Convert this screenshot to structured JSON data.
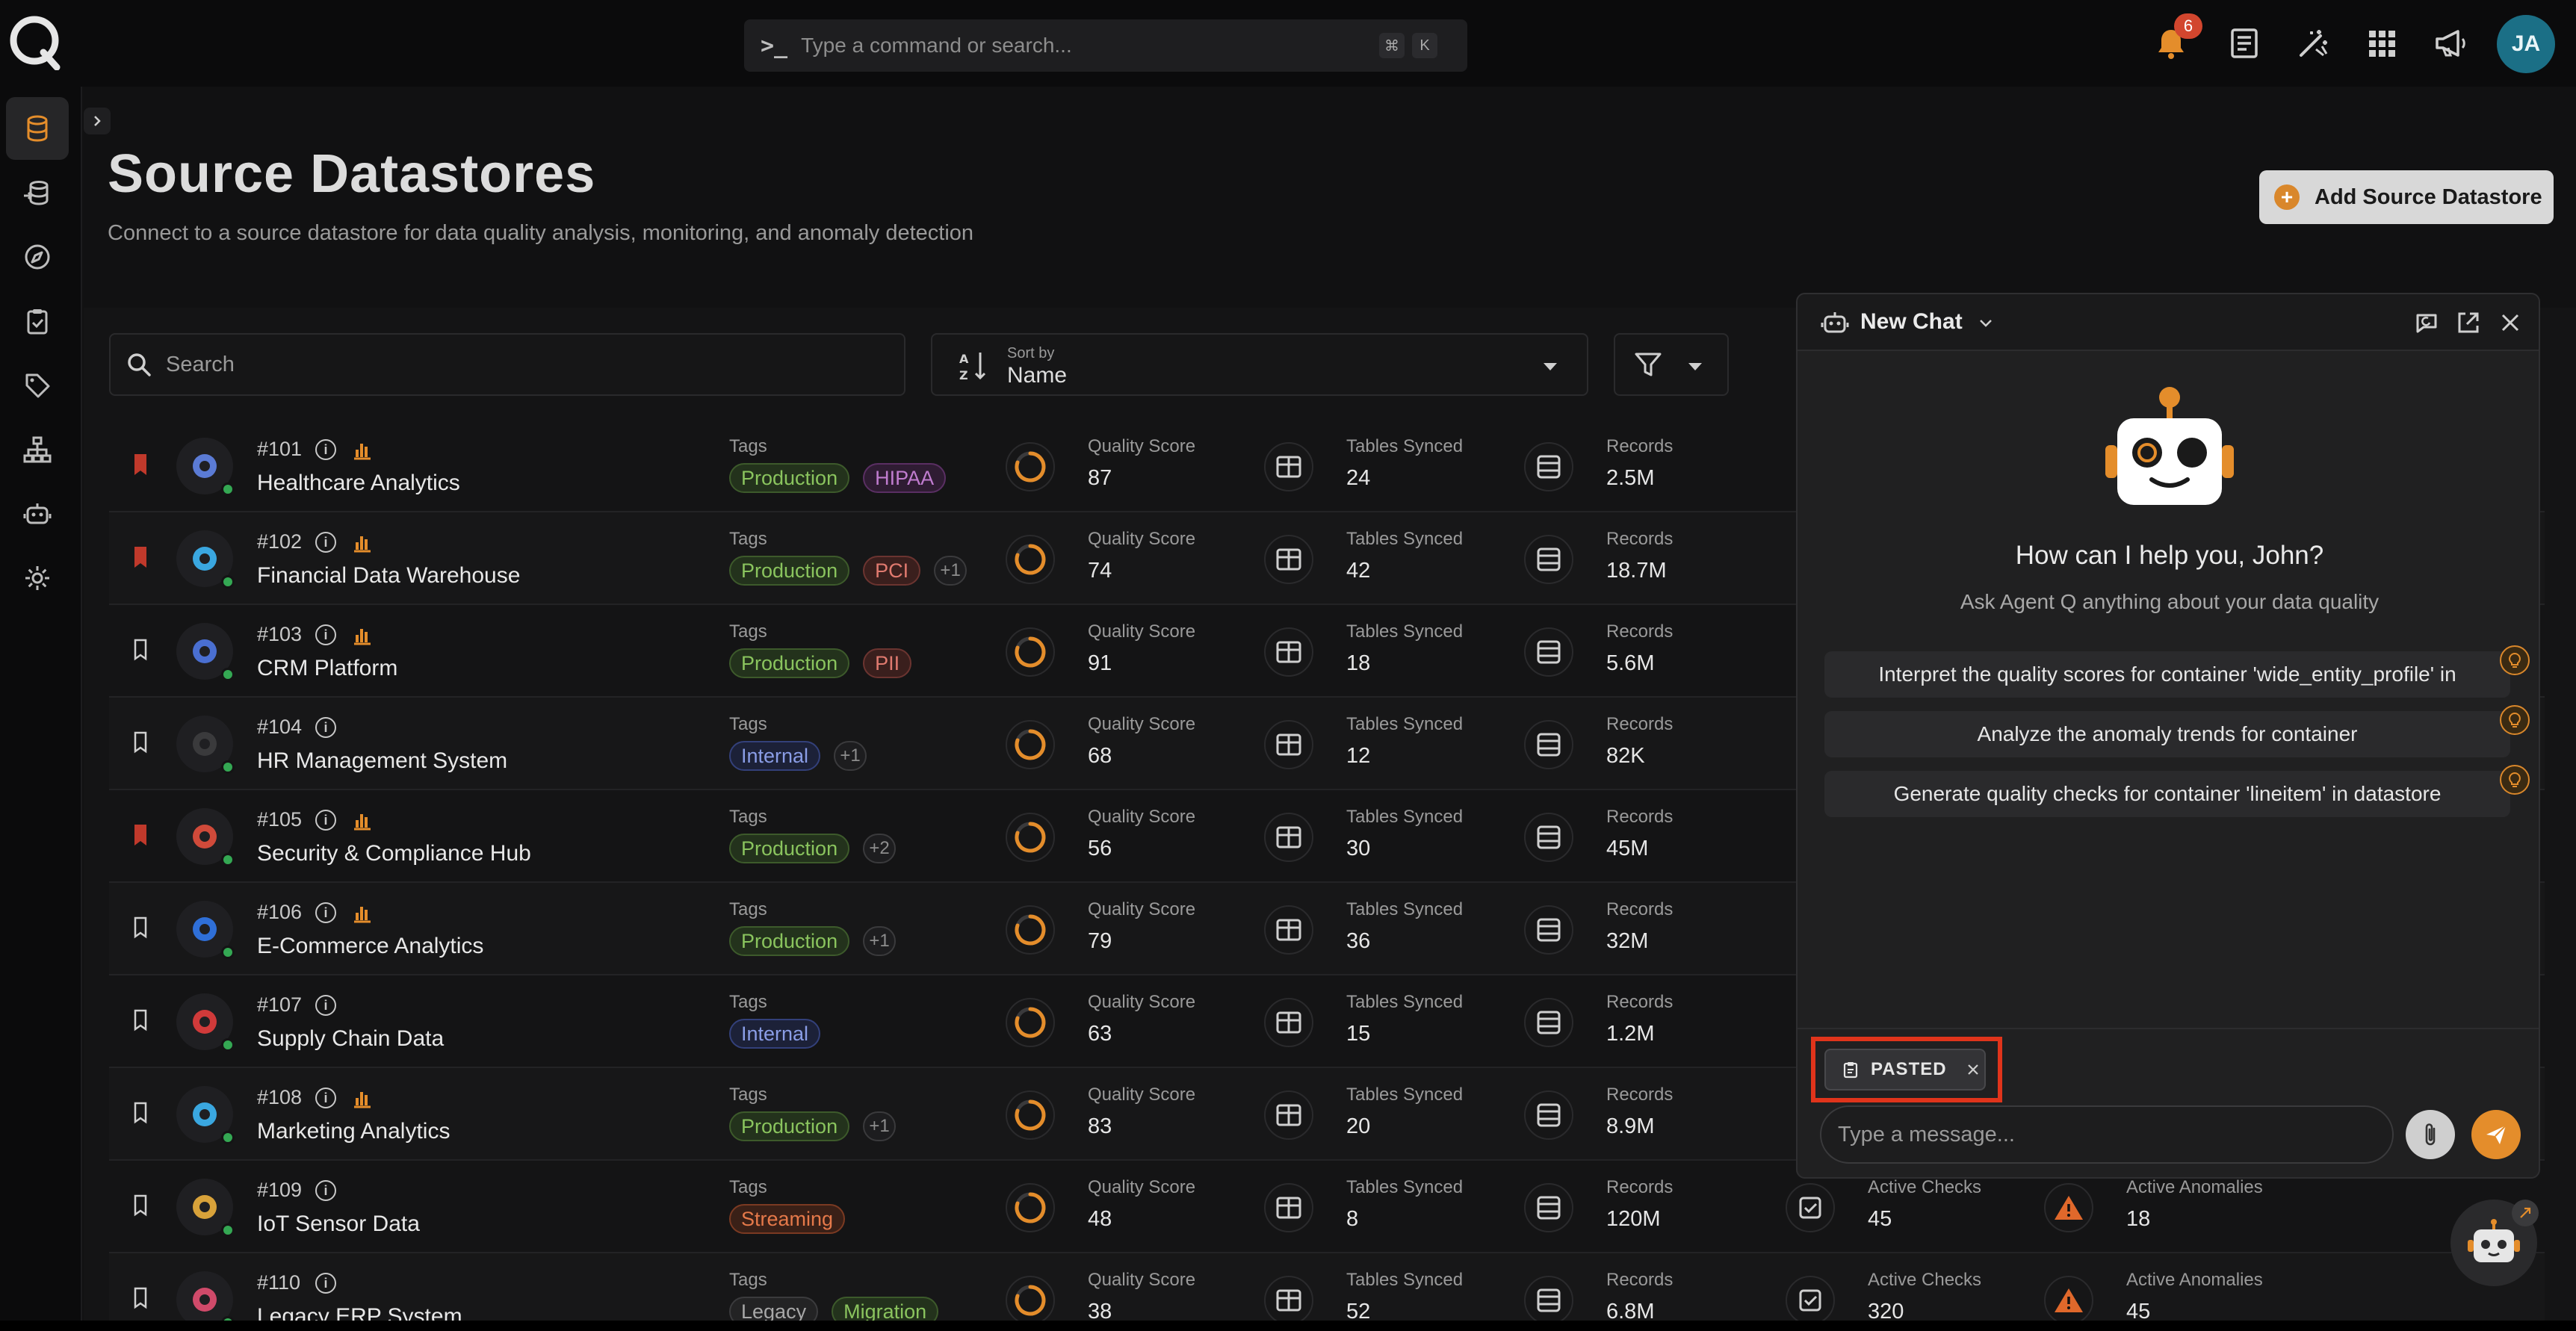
{
  "command_bar": {
    "placeholder": "Type a command or search...",
    "shortcut_mod": "⌘",
    "shortcut_key": "K"
  },
  "notifications": {
    "count": "6"
  },
  "user": {
    "initials": "JA"
  },
  "page": {
    "title": "Source Datastores",
    "subtitle": "Connect to a source datastore for data quality analysis, monitoring, and anomaly detection",
    "add_button": "Add Source Datastore"
  },
  "search": {
    "placeholder": "Search"
  },
  "sort": {
    "label": "Sort by",
    "value": "Name"
  },
  "rows": [
    {
      "id": "#101",
      "name": "Healthcare Analytics",
      "bookmarked": true,
      "chart": true,
      "tags": [
        [
          "Production",
          "t-prod"
        ],
        [
          "HIPAA",
          "t-hipaa"
        ]
      ],
      "more": "",
      "quality": "87",
      "tables": "24",
      "records": "2.5M",
      "checks": "",
      "anomalies": ""
    },
    {
      "id": "#102",
      "name": "Financial Data Warehouse",
      "bookmarked": true,
      "chart": true,
      "tags": [
        [
          "Production",
          "t-prod"
        ],
        [
          "PCI",
          "t-pci"
        ]
      ],
      "more": "+1",
      "quality": "74",
      "tables": "42",
      "records": "18.7M",
      "checks": "",
      "anomalies": ""
    },
    {
      "id": "#103",
      "name": "CRM Platform",
      "bookmarked": false,
      "chart": true,
      "tags": [
        [
          "Production",
          "t-prod"
        ],
        [
          "PII",
          "t-pii"
        ]
      ],
      "more": "",
      "quality": "91",
      "tables": "18",
      "records": "5.6M",
      "checks": "",
      "anomalies": ""
    },
    {
      "id": "#104",
      "name": "HR Management System",
      "bookmarked": false,
      "chart": false,
      "tags": [
        [
          "Internal",
          "t-int"
        ]
      ],
      "more": "+1",
      "quality": "68",
      "tables": "12",
      "records": "82K",
      "checks": "",
      "anomalies": ""
    },
    {
      "id": "#105",
      "name": "Security & Compliance Hub",
      "bookmarked": true,
      "chart": true,
      "tags": [
        [
          "Production",
          "t-prod"
        ]
      ],
      "more": "+2",
      "quality": "56",
      "tables": "30",
      "records": "45M",
      "checks": "",
      "anomalies": ""
    },
    {
      "id": "#106",
      "name": "E-Commerce Analytics",
      "bookmarked": false,
      "chart": true,
      "tags": [
        [
          "Production",
          "t-prod"
        ]
      ],
      "more": "+1",
      "quality": "79",
      "tables": "36",
      "records": "32M",
      "checks": "",
      "anomalies": ""
    },
    {
      "id": "#107",
      "name": "Supply Chain Data",
      "bookmarked": false,
      "chart": false,
      "tags": [
        [
          "Internal",
          "t-int"
        ]
      ],
      "more": "",
      "quality": "63",
      "tables": "15",
      "records": "1.2M",
      "checks": "",
      "anomalies": ""
    },
    {
      "id": "#108",
      "name": "Marketing Analytics",
      "bookmarked": false,
      "chart": true,
      "tags": [
        [
          "Production",
          "t-prod"
        ]
      ],
      "more": "+1",
      "quality": "83",
      "tables": "20",
      "records": "8.9M",
      "checks": "",
      "anomalies": ""
    },
    {
      "id": "#109",
      "name": "IoT Sensor Data",
      "bookmarked": false,
      "chart": false,
      "tags": [
        [
          "Streaming",
          "t-stream"
        ]
      ],
      "more": "",
      "quality": "48",
      "tables": "8",
      "records": "120M",
      "checks": "45",
      "anomalies": "18"
    },
    {
      "id": "#110",
      "name": "Legacy ERP System",
      "bookmarked": false,
      "chart": false,
      "tags": [
        [
          "Legacy",
          "t-legacy"
        ],
        [
          "Migration",
          "t-migr"
        ]
      ],
      "more": "",
      "quality": "38",
      "tables": "52",
      "records": "6.8M",
      "checks": "320",
      "anomalies": "45"
    }
  ],
  "labels": {
    "tags": "Tags",
    "quality": "Quality Score",
    "tables": "Tables Synced",
    "records": "Records",
    "checks": "Active Checks",
    "anomalies": "Active Anomalies"
  },
  "chat": {
    "title": "New Chat",
    "greeting": "How can I help you, John?",
    "greeting_sub": "Ask Agent Q anything about your data quality",
    "suggestions": [
      "Interpret the quality scores for container 'wide_entity_profile' in",
      "Analyze the anomaly trends for container",
      "Generate quality checks for container 'lineitem' in datastore"
    ],
    "pasted_label": "PASTED",
    "message_placeholder": "Type a message..."
  },
  "colors": {
    "accent": "#e48d2b",
    "highlight": "#e0341b",
    "status_green": "#34a853"
  }
}
